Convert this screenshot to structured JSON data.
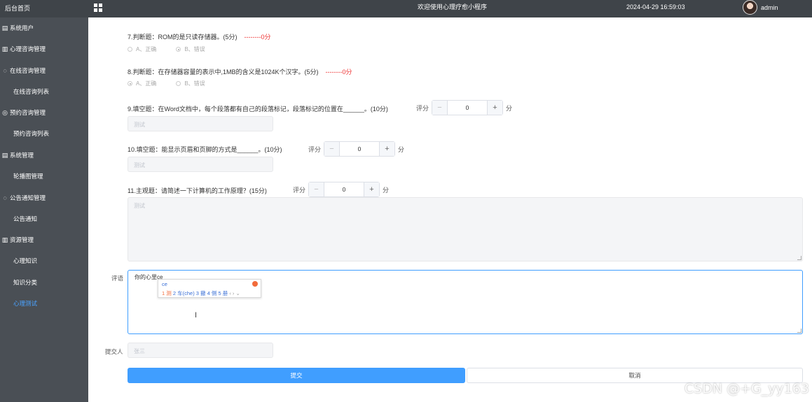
{
  "sidebar": {
    "brand": "后台首页",
    "items": [
      {
        "label": "系统用户",
        "type": "top",
        "icon": "list-icon"
      },
      {
        "label": "心理咨询管理",
        "type": "top",
        "icon": "bar-chart-icon"
      },
      {
        "label": "在线咨询管理",
        "type": "top",
        "icon": "chat-icon"
      },
      {
        "label": "在线咨询列表",
        "type": "sub"
      },
      {
        "label": "预约咨询管理",
        "type": "top",
        "icon": "check-circle-icon"
      },
      {
        "label": "预约咨询列表",
        "type": "sub"
      },
      {
        "label": "系统管理",
        "type": "top",
        "icon": "list-icon"
      },
      {
        "label": "轮播图管理",
        "type": "sub"
      },
      {
        "label": "公告通知管理",
        "type": "top",
        "icon": "chat-icon"
      },
      {
        "label": "公告通知",
        "type": "sub"
      },
      {
        "label": "资源管理",
        "type": "top",
        "icon": "bar-chart-icon"
      },
      {
        "label": "心理知识",
        "type": "sub"
      },
      {
        "label": "知识分类",
        "type": "sub"
      },
      {
        "label": "心理测试",
        "type": "sub",
        "active": true
      }
    ]
  },
  "header": {
    "title": "欢迎使用心理疗愈小程序",
    "datetime": "2024-04-29 16:59:03",
    "username": "admin"
  },
  "questions": {
    "q7": {
      "text": "7.判断题：ROM的是只读存储器。(5分)",
      "score": "--------0分",
      "options": [
        "A、正确",
        "B、错误"
      ],
      "selected": 1
    },
    "q8": {
      "text": "8.判断题：在存储器容量的表示中,1MB的含义是1024K个汉字。(5分)",
      "score": "--------0分",
      "options": [
        "A、正确",
        "B、错误"
      ],
      "selected": 0
    },
    "q9": {
      "text": "9.填空题：在Word文档中，每个段落都有自己的段落标记，段落标记的位置在______。(10分)",
      "answer": "测试",
      "score_label": "评分",
      "score_value": "0",
      "unit": "分"
    },
    "q10": {
      "text": "10.填空题：能显示页眉和页脚的方式是______。(10分)",
      "answer": "测试",
      "score_label": "评分",
      "score_value": "0",
      "unit": "分"
    },
    "q11": {
      "text": "11.主观题：请简述一下计算机的工作原理？(15分)",
      "answer": "测试",
      "score_label": "评分",
      "score_value": "0",
      "unit": "分"
    }
  },
  "stepper": {
    "minus": "−",
    "plus": "+"
  },
  "comment": {
    "label": "评语",
    "value": "你的心里ce"
  },
  "ime": {
    "composition": "ce",
    "candidates": "1 测  2 车(che)  3 撤  4 侧  5 册",
    "first": "1 测",
    "rest": "  2 车(che)  3 撤  4 侧  5 册",
    "nav": "‹ › ⌄"
  },
  "submitter": {
    "label": "提交人",
    "value": "张三"
  },
  "actions": {
    "submit": "提交",
    "cancel": "取消"
  },
  "watermark": "CSDN @+G_yy163"
}
